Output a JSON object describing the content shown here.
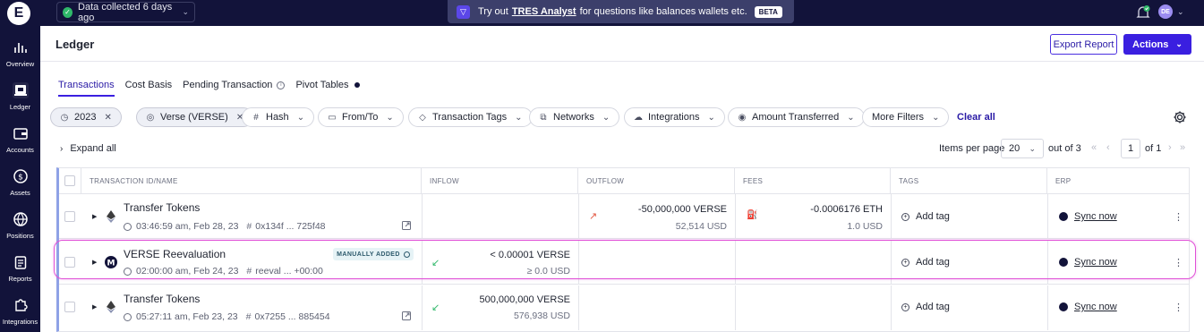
{
  "sidebar": {
    "logo": "E",
    "items": [
      {
        "label": "Overview",
        "icon": "chart-icon"
      },
      {
        "label": "Ledger",
        "icon": "ledger-icon",
        "active": true
      },
      {
        "label": "Accounts",
        "icon": "wallet-icon"
      },
      {
        "label": "Assets",
        "icon": "dollar-icon"
      },
      {
        "label": "Positions",
        "icon": "globe-icon"
      },
      {
        "label": "Reports",
        "icon": "clipboard-icon"
      },
      {
        "label": "Integrations",
        "icon": "puzzle-icon"
      }
    ]
  },
  "topbar": {
    "data_status": "Data collected 6 days ago",
    "promo_prefix": "Try out",
    "promo_link": "TRES Analyst",
    "promo_suffix": "for questions like balances wallets etc.",
    "promo_badge": "BETA",
    "avatar_initials": "DE"
  },
  "header": {
    "title": "Ledger",
    "export_label": "Export Report",
    "actions_label": "Actions"
  },
  "tabs": [
    {
      "label": "Transactions",
      "active": true
    },
    {
      "label": "Cost Basis"
    },
    {
      "label": "Pending Transaction"
    },
    {
      "label": "Pivot Tables"
    }
  ],
  "filters": {
    "chips": [
      "2023",
      "Verse (VERSE)",
      "Hash",
      "From/To",
      "Transaction Tags",
      "Networks",
      "Integrations",
      "Amount Transferred",
      "More Filters"
    ],
    "clear_all": "Clear all"
  },
  "toolbar": {
    "expand_all": "Expand all",
    "items_per_page_label": "Items per page",
    "items_per_page": "20",
    "out_of": "out of 3",
    "page": "1",
    "of_pages": "of 1"
  },
  "table": {
    "columns": [
      "TRANSACTION ID/NAME",
      "INFLOW",
      "OUTFLOW",
      "FEES",
      "TAGS",
      "ERP"
    ],
    "rows": [
      {
        "name": "Transfer Tokens",
        "time": "03:46:59 am, Feb 28, 23",
        "hash": "0x134f ... 725f48",
        "chain_icon": "ethereum-icon",
        "inflow": "",
        "inflow_usd": "",
        "outflow": "-50,000,000 VERSE",
        "outflow_usd": "52,514 USD",
        "fees": "-0.0006176 ETH",
        "fees_usd": "1.0 USD",
        "tags_label": "Add tag",
        "erp_label": "Sync now"
      },
      {
        "name": "VERSE Reevaluation",
        "time": "02:00:00 am, Feb 24, 23",
        "hash": "reeval ... +00:00",
        "chain_icon": "verse-icon",
        "badge": "MANUALLY ADDED",
        "inflow": "< 0.00001 VERSE",
        "inflow_usd": "≥ 0.0 USD",
        "outflow": "",
        "outflow_usd": "",
        "fees": "",
        "fees_usd": "",
        "tags_label": "Add tag",
        "erp_label": "Sync now"
      },
      {
        "name": "Transfer Tokens",
        "time": "05:27:11 am, Feb 23, 23",
        "hash": "0x7255 ... 885454",
        "chain_icon": "ethereum-icon",
        "inflow": "500,000,000 VERSE",
        "inflow_usd": "576,938 USD",
        "outflow": "",
        "outflow_usd": "",
        "fees": "",
        "fees_usd": "",
        "tags_label": "Add tag",
        "erp_label": "Sync now"
      }
    ]
  },
  "colors": {
    "sidebar_bg": "#12133a",
    "accent": "#3a1fe0",
    "highlight": "#e04fd6",
    "inflow_arrow": "#2fb86a",
    "outflow_arrow": "#e2553f"
  }
}
